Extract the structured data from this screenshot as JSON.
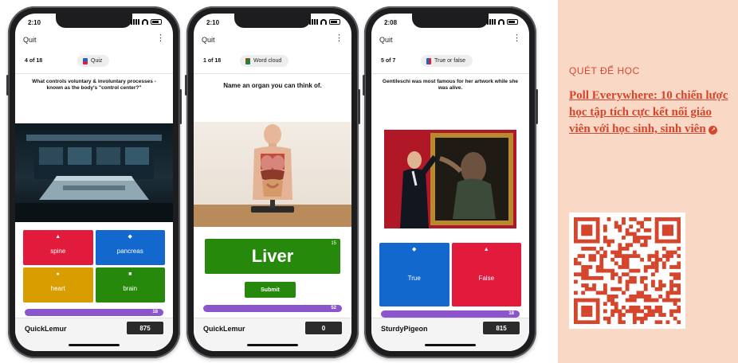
{
  "phones": [
    {
      "time": "2:10",
      "quit": "Quit",
      "progress": "4 of 18",
      "type_label": "Quiz",
      "question": "What controls voluntary & involuntary processes - known as the body's \"control center?\"",
      "answers": [
        "spine",
        "pancreas",
        "heart",
        "brain"
      ],
      "timer": "18",
      "nickname": "QuickLemur",
      "score": "875"
    },
    {
      "time": "2:10",
      "quit": "Quit",
      "progress": "1 of 18",
      "type_label": "Word cloud",
      "question": "Name an organ you can think of.",
      "response_value": "Liver",
      "char_count": "15",
      "submit_label": "Submit",
      "timer": "52",
      "nickname": "QuickLemur",
      "score": "0"
    },
    {
      "time": "2:08",
      "quit": "Quit",
      "progress": "5 of 7",
      "type_label": "True or false",
      "question": "Gentileschi was most famous for her artwork while she was alive.",
      "answers": [
        "True",
        "False"
      ],
      "timer": "18",
      "nickname": "SturdyPigeon",
      "score": "815"
    }
  ],
  "side_panel": {
    "label": "QUÉT ĐỂ HỌC",
    "link_text": "Poll Everywhere: 10 chiến lược học tập tích cực kết nối giáo viên với học sinh, sinh viên"
  },
  "colors": {
    "red": "#e21b3c",
    "blue": "#1368ce",
    "yellow": "#d89e00",
    "green": "#26890c",
    "purple": "#8b55cc",
    "panel_bg": "#f9d9c6",
    "accent": "#d5452c"
  },
  "icons": {
    "quiz": "quiz-icon",
    "word_cloud": "word-cloud-icon",
    "true_false": "true-false-icon",
    "external_link": "external-link-icon"
  }
}
